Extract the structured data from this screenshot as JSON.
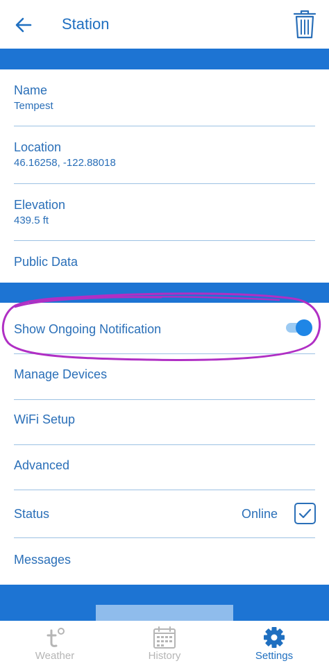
{
  "header": {
    "title": "Station"
  },
  "station": {
    "name_label": "Name",
    "name_value": "Tempest",
    "location_label": "Location",
    "location_value": "46.16258, -122.88018",
    "elevation_label": "Elevation",
    "elevation_value": "439.5 ft",
    "public_data_label": "Public Data"
  },
  "settings": {
    "notification_label": "Show Ongoing Notification",
    "notification_enabled": true,
    "manage_devices_label": "Manage Devices",
    "wifi_setup_label": "WiFi Setup",
    "advanced_label": "Advanced",
    "status_label": "Status",
    "status_value": "Online",
    "status_checked": true,
    "messages_label": "Messages"
  },
  "tabs": [
    {
      "label": "Weather",
      "icon": "tempest-logo-icon",
      "active": false
    },
    {
      "label": "History",
      "icon": "calendar-icon",
      "active": false
    },
    {
      "label": "Settings",
      "icon": "gear-icon",
      "active": true
    }
  ],
  "colors": {
    "brand_blue": "#1d74d3",
    "text_blue": "#2a6fb8",
    "toggle_on": "#1f86e6",
    "annotation_purple": "#b02fc4"
  }
}
